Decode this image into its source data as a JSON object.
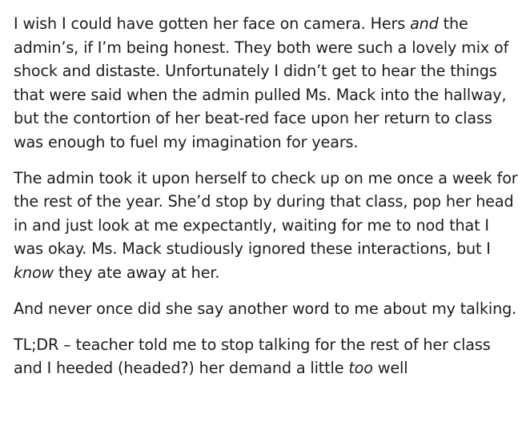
{
  "post": {
    "paragraphs": [
      {
        "segments": [
          {
            "text": "I wish I could have gotten her face on camera. Hers "
          },
          {
            "text": "and",
            "em": true
          },
          {
            "text": " the admin’s, if I’m being honest. They both were such a lovely mix of shock and distaste. Unfortunately I didn’t get to hear the things that were said when the admin pulled Ms. Mack into the hallway, but the contortion of her beat-red face upon her return to class was enough to fuel my imagination for years."
          }
        ]
      },
      {
        "segments": [
          {
            "text": "The admin took it upon herself to check up on me once a week for the rest of the year. She’d stop by during that class, pop her head in and just look at me expectantly, waiting for me to nod that I was okay. Ms. Mack studiously ignored these interactions, but I "
          },
          {
            "text": "know",
            "em": true
          },
          {
            "text": " they ate away at her."
          }
        ]
      },
      {
        "segments": [
          {
            "text": "And never once did she say another word to me about my talking."
          }
        ]
      },
      {
        "segments": [
          {
            "text": "TL;DR – teacher told me to stop talking for the rest of her class and I heeded (headed?) her demand a little "
          },
          {
            "text": "too",
            "em": true
          },
          {
            "text": " well"
          }
        ]
      }
    ]
  }
}
